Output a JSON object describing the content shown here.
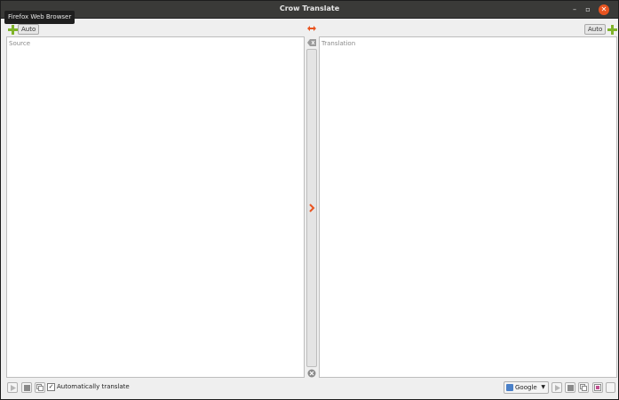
{
  "window": {
    "title": "Crow Translate",
    "minimize_glyph": "–",
    "maximize_glyph": "▫",
    "close_glyph": "✕"
  },
  "tooltip": "Firefox Web Browser",
  "source": {
    "language_button": "Auto",
    "placeholder": "Source"
  },
  "translation": {
    "language_button": "Auto",
    "placeholder": "Translation"
  },
  "bottom": {
    "auto_translate_label": "Automatically translate",
    "auto_translate_checked": "✓",
    "engine": "Google"
  },
  "colors": {
    "accent": "#e95420",
    "add_icon": "#7fb32a"
  }
}
